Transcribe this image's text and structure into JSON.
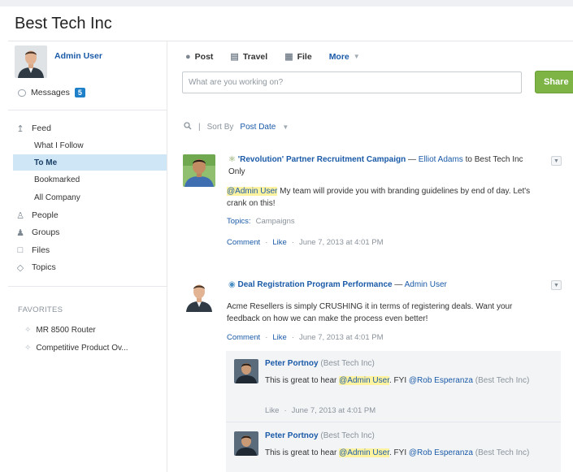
{
  "page": {
    "title": "Best Tech Inc"
  },
  "profile": {
    "name": "Admin User"
  },
  "messages": {
    "label": "Messages",
    "count": "5"
  },
  "nav": {
    "feed": "Feed",
    "feed_items": [
      "What I Follow",
      "To Me",
      "Bookmarked",
      "All Company"
    ],
    "active_item": "To Me",
    "people": "People",
    "groups": "Groups",
    "files": "Files",
    "topics": "Topics"
  },
  "favorites": {
    "heading": "FAVORITES",
    "items": [
      "MR 8500 Router",
      "Competitive Product Ov..."
    ]
  },
  "publisher": {
    "tabs": {
      "post": "Post",
      "travel": "Travel",
      "file": "File",
      "more": "More"
    },
    "placeholder": "What are you working on?",
    "share_label": "Share"
  },
  "sort": {
    "label": "Sort By",
    "value": "Post Date"
  },
  "posts": [
    {
      "group": "'Revolution' Partner Recruitment Campaign",
      "dash": "—",
      "author": "Elliot Adams",
      "to_text": "to Best Tech Inc Only",
      "mention": "@Admin User",
      "body": "My team will provide you with branding guidelines by end of day. Let's crank on this!",
      "topics_label": "Topics:",
      "topics_value": "Campaigns",
      "comment": "Comment",
      "like": "Like",
      "dot": "·",
      "timestamp": "June 7, 2013 at 4:01 PM"
    },
    {
      "group": "Deal Registration Program Performance",
      "dash": "—",
      "author": "Admin User",
      "body": "Acme Resellers is simply CRUSHING it in terms of registering deals. Want your feedback on how we can make the process even better!",
      "comment": "Comment",
      "like": "Like",
      "dot": "·",
      "timestamp": "June 7, 2013 at 4:01 PM",
      "comments": [
        {
          "author": "Peter Portnoy",
          "company": "(Best Tech Inc)",
          "text_before": "This is great to hear",
          "mention": "@Admin User",
          "text_mid": ". FYI",
          "mention2": "@Rob Esperanza",
          "text_after": "(Best Tech Inc)",
          "like": "Like",
          "dot": "·",
          "timestamp": "June 7, 2013 at 4:01 PM"
        },
        {
          "author": "Peter Portnoy",
          "company": "(Best Tech Inc)",
          "text_before": "This is great to hear",
          "mention": "@Admin User",
          "text_mid": ". FYI",
          "mention2": "@Rob Esperanza",
          "text_after": "(Best Tech Inc)"
        }
      ]
    }
  ],
  "colors": {
    "accent": "#1a5aa8",
    "share": "#7db445",
    "active_nav": "#cfe6f6",
    "mention_highlight": "#fff3a0"
  },
  "icons": [
    "messages-icon",
    "feed-icon",
    "people-icon",
    "groups-icon",
    "files-icon",
    "topics-icon",
    "star-icon",
    "post-icon",
    "travel-icon",
    "file-icon",
    "search-icon",
    "group-icon",
    "menu-icon"
  ]
}
